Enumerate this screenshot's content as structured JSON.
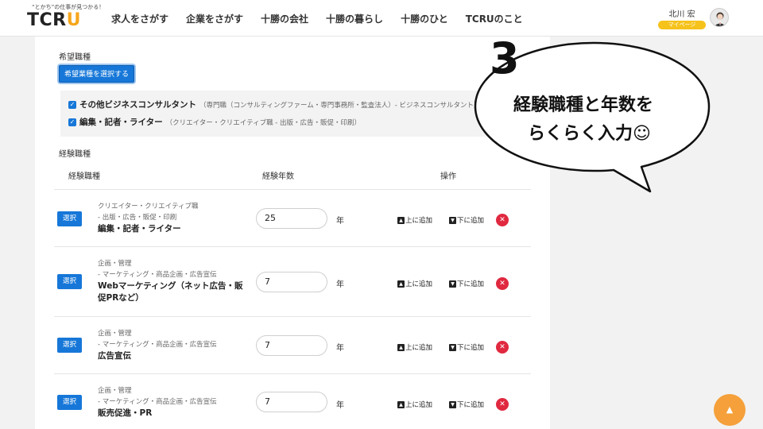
{
  "header": {
    "logo_tagline": "“とかち”の仕事が見つかる！",
    "logo_main": "TCR",
    "logo_accent": "U",
    "nav": [
      "求人をさがす",
      "企業をさがす",
      "十勝の会社",
      "十勝の暮らし",
      "十勝のひと",
      "TCRUのこと"
    ],
    "user_name": "北川 宏",
    "mypage_label": "マイページ"
  },
  "desired": {
    "label": "希望職種",
    "select_button": "希望業種を選択する",
    "items": [
      {
        "main": "その他ビジネスコンサルタント",
        "sub": "（専門職（コンサルティングファーム・専門事務所・監査法人）- ビジネスコンサルタント）"
      },
      {
        "main": "編集・記者・ライター",
        "sub": "（クリエイター・クリエイティブ職 - 出版・広告・販促・印刷）"
      }
    ]
  },
  "experience": {
    "label": "経験職種",
    "columns": {
      "job": "経験職種",
      "years": "経験年数",
      "ops": "操作"
    },
    "select_label": "選択",
    "unit": "年",
    "add_up": "上に追加",
    "add_down": "下に追加",
    "rows": [
      {
        "cat1": "クリエイター・クリエイティブ職",
        "cat2": "- 出版・広告・販促・印刷",
        "job": "編集・記者・ライター",
        "years": "25"
      },
      {
        "cat1": "企画・管理",
        "cat2": "- マーケティング・商品企画・広告宣伝",
        "job": "Webマーケティング（ネット広告・販促PRなど）",
        "years": "7"
      },
      {
        "cat1": "企画・管理",
        "cat2": "- マーケティング・商品企画・広告宣伝",
        "job": "広告宣伝",
        "years": "7"
      },
      {
        "cat1": "企画・管理",
        "cat2": "- マーケティング・商品企画・広告宣伝",
        "job": "販売促進・PR",
        "years": "7"
      }
    ]
  },
  "callout": {
    "number": "3",
    "line1": "経験職種と年数を",
    "line2": "らくらく入力☺"
  },
  "colors": {
    "primary": "#1677d8",
    "accent": "#f6a61d",
    "delete": "#e0283f",
    "scroll_button": "#f5a03a"
  }
}
